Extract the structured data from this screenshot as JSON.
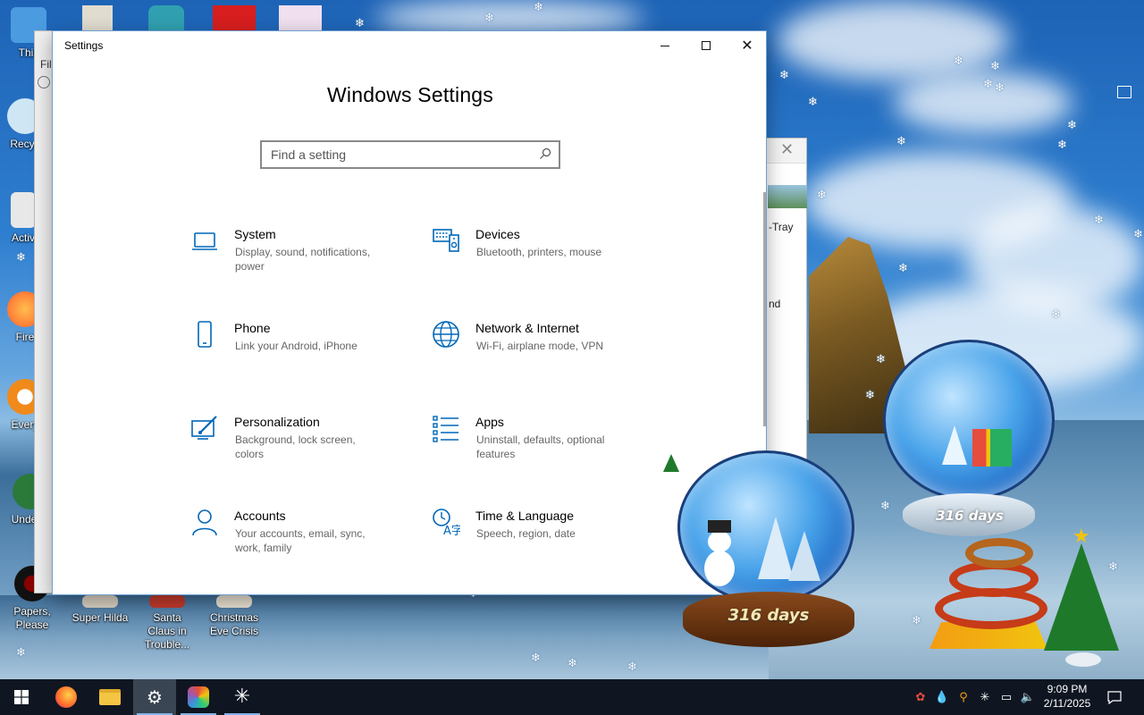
{
  "desktop": {
    "icons": [
      {
        "label": "This",
        "color": "#4b9be0"
      },
      {
        "label": "Recyc",
        "color": "#cfe6f5"
      },
      {
        "label": "Activ",
        "color": "#e8e8e8"
      },
      {
        "label": "Fire",
        "color": "#ff7a1a"
      },
      {
        "label": "Every",
        "color": "#f08a1a"
      },
      {
        "label": "Underta",
        "color": "#2b7a3a"
      },
      {
        "label": "Papers, Please",
        "color": "#1c1c1c"
      },
      {
        "label": "Super Hilda",
        "color": "#d8d0c0"
      },
      {
        "label": "Santa Claus in Trouble...",
        "color": "#c0392b"
      },
      {
        "label": "Christmas Eve Crisis",
        "color": "#e8e0d0"
      }
    ],
    "background_window": {
      "fragment_1": "Fil",
      "fragment_2": "-Tray",
      "fragment_3": "nd"
    }
  },
  "settings_window": {
    "title": "Settings",
    "heading": "Windows Settings",
    "search": {
      "placeholder": "Find a setting"
    },
    "accent": "#0067b8",
    "categories": [
      {
        "name": "System",
        "desc": "Display, sound, notifications, power",
        "icon": "laptop-icon"
      },
      {
        "name": "Devices",
        "desc": "Bluetooth, printers, mouse",
        "icon": "keyboard-speaker-icon"
      },
      {
        "name": "Phone",
        "desc": "Link your Android, iPhone",
        "icon": "phone-icon"
      },
      {
        "name": "Network & Internet",
        "desc": "Wi-Fi, airplane mode, VPN",
        "icon": "globe-icon"
      },
      {
        "name": "Personalization",
        "desc": "Background, lock screen, colors",
        "icon": "paint-brush-icon"
      },
      {
        "name": "Apps",
        "desc": "Uninstall, defaults, optional features",
        "icon": "apps-list-icon"
      },
      {
        "name": "Accounts",
        "desc": "Your accounts, email, sync, work, family",
        "icon": "person-icon"
      },
      {
        "name": "Time & Language",
        "desc": "Speech, region, date",
        "icon": "time-language-icon"
      }
    ]
  },
  "widgets": {
    "globe_small_days": "316 days",
    "globe_large_days": "316 days"
  },
  "taskbar": {
    "apps": [
      "start-icon",
      "firefox-icon",
      "file-explorer-icon",
      "settings-icon",
      "colorful-app-icon",
      "snowflake-app-icon"
    ],
    "time": "9:09 PM",
    "date": "2/11/2025"
  }
}
